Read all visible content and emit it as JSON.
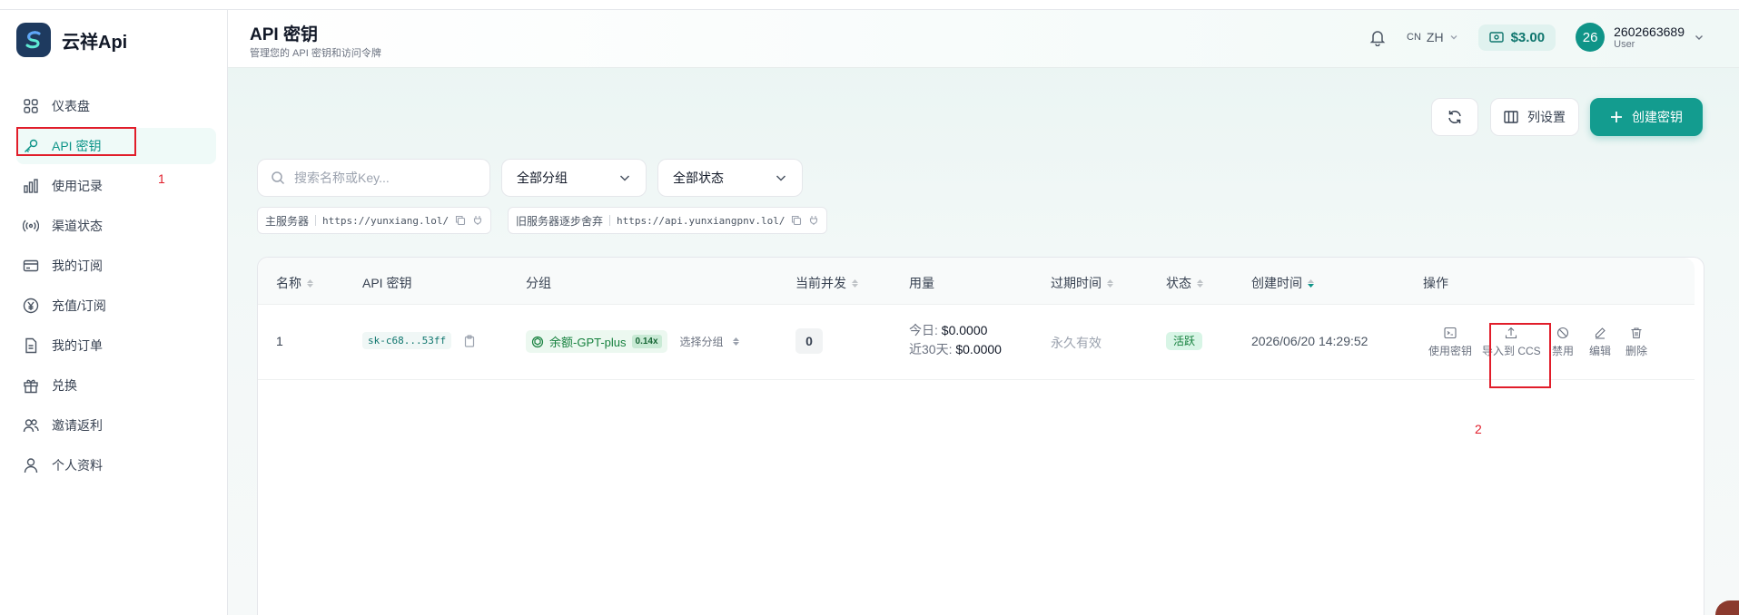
{
  "brand": {
    "name": "云祥Api"
  },
  "sidebar": {
    "items": [
      {
        "label": "仪表盘",
        "icon": "dashboard-icon"
      },
      {
        "label": "API 密钥",
        "icon": "key-icon",
        "active": true
      },
      {
        "label": "使用记录",
        "icon": "bar-chart-icon"
      },
      {
        "label": "渠道状态",
        "icon": "signal-icon"
      },
      {
        "label": "我的订阅",
        "icon": "card-icon"
      },
      {
        "label": "充值/订阅",
        "icon": "yen-icon"
      },
      {
        "label": "我的订单",
        "icon": "document-icon"
      },
      {
        "label": "兑换",
        "icon": "gift-icon"
      },
      {
        "label": "邀请返利",
        "icon": "users-icon"
      },
      {
        "label": "个人资料",
        "icon": "user-icon"
      }
    ]
  },
  "annotations": {
    "label1": "1",
    "label2": "2",
    "color": "#e11d2a"
  },
  "header": {
    "title": "API 密钥",
    "subtitle": "管理您的 API 密钥和访问令牌",
    "lang_prefix": "CN",
    "lang": "ZH",
    "balance": "$3.00",
    "avatar_text": "26",
    "username": "2602663689",
    "role": "User"
  },
  "toolbar": {
    "columns_label": "列设置",
    "create_label": "创建密钥"
  },
  "filters": {
    "search_placeholder": "搜索名称或Key...",
    "group_select": "全部分组",
    "status_select": "全部状态"
  },
  "servers": {
    "primary_label": "主服务器",
    "primary_url": "https://yunxiang.lol/",
    "legacy_label": "旧服务器逐步舍弃",
    "legacy_url": "https://api.yunxiangpnv.lol/"
  },
  "table": {
    "headers": {
      "name": "名称",
      "key": "API 密钥",
      "group": "分组",
      "concurrency": "当前并发",
      "usage": "用量",
      "expires": "过期时间",
      "status": "状态",
      "created": "创建时间",
      "actions": "操作"
    },
    "rows": [
      {
        "name": "1",
        "key": "sk-c68...53ff",
        "group_name": "余额-GPT-plus",
        "group_mult": "0.14x",
        "group_select": "选择分组",
        "concurrency": "0",
        "usage_today_label": "今日:",
        "usage_today": "$0.0000",
        "usage_30d_label": "近30天:",
        "usage_30d": "$0.0000",
        "expires": "永久有效",
        "status": "活跃",
        "created": "2026/06/20 14:29:52",
        "actions": {
          "use": "使用密钥",
          "import": "导入到 CCS",
          "disable": "禁用",
          "edit": "编辑",
          "delete": "删除"
        }
      }
    ]
  },
  "colors": {
    "accent": "#139c8f",
    "accent_bg": "#e0f2ef",
    "status_green": "#15803d"
  }
}
